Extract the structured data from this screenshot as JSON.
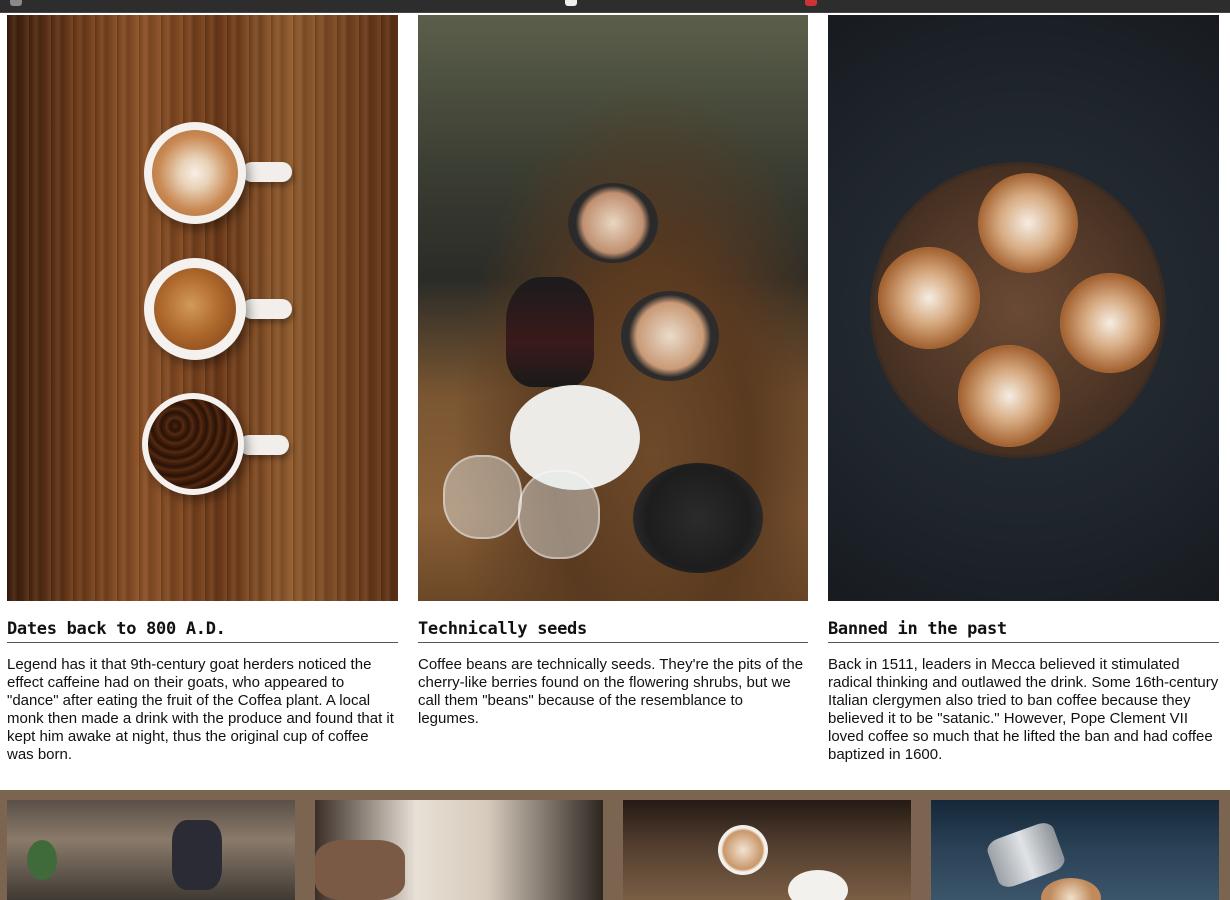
{
  "cards": [
    {
      "title": "Dates back to 800 A.D.",
      "text": "Legend has it that 9th-century goat herders noticed the effect caffeine had on their goats, who appeared to \"dance\" after eating the fruit of the Coffea plant. A local monk then made a drink with the produce and found that it kept him awake at night, thus the original cup of coffee was born."
    },
    {
      "title": "Technically seeds",
      "text": "Coffee beans are technically seeds. They're the pits of the cherry-like berries found on the flowering shrubs, but we call them \"beans\" because of the resemblance to legumes."
    },
    {
      "title": "Banned in the past",
      "text": "Back in 1511, leaders in Mecca believed it stimulated radical thinking and outlawed the drink. Some 16th-century Italian clergymen also tried to ban coffee because they believed it to be \"satanic.\" However, Pope Clement VII loved coffee so much that he lifted the ban and had coffee baptized in 1600."
    }
  ],
  "colors": {
    "strip_background": "#7b6450",
    "heading_rule": "#555555"
  }
}
